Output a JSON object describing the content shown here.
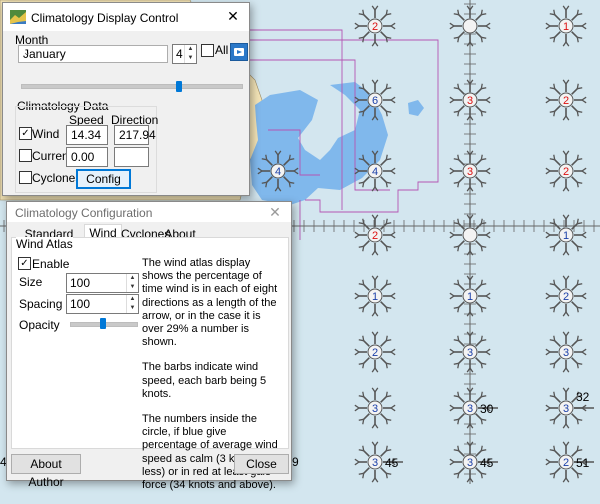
{
  "map": {
    "background_color": "#d3e6ef",
    "land_color": "#f2e3b6",
    "shallow_color": "#80b8ec",
    "graticule_label_color": "#333333",
    "barbs": [
      {
        "row": 0,
        "col": 0,
        "n": "2",
        "color": "red",
        "ext": ""
      },
      {
        "row": 0,
        "col": 1,
        "n": "",
        "color": "none",
        "ext": ""
      },
      {
        "row": 0,
        "col": 2,
        "n": "1",
        "color": "red",
        "ext": ""
      },
      {
        "row": 1,
        "col": 0,
        "n": "6",
        "color": "blue",
        "ext": ""
      },
      {
        "row": 1,
        "col": 1,
        "n": "3",
        "color": "red",
        "ext": ""
      },
      {
        "row": 1,
        "col": 2,
        "n": "2",
        "color": "red",
        "ext": ""
      },
      {
        "row": 2,
        "col": -1,
        "n": "4",
        "color": "blue",
        "ext": ""
      },
      {
        "row": 2,
        "col": 0,
        "n": "4",
        "color": "blue",
        "ext": ""
      },
      {
        "row": 2,
        "col": 1,
        "n": "3",
        "color": "red",
        "ext": ""
      },
      {
        "row": 2,
        "col": 2,
        "n": "2",
        "color": "red",
        "ext": ""
      },
      {
        "row": 3,
        "col": 0,
        "n": "2",
        "color": "red",
        "ext": ""
      },
      {
        "row": 3,
        "col": 1,
        "n": "",
        "color": "none",
        "ext": ""
      },
      {
        "row": 3,
        "col": 2,
        "n": "1",
        "color": "blue",
        "ext": ""
      },
      {
        "row": 4,
        "col": 0,
        "n": "1",
        "color": "blue",
        "ext": ""
      },
      {
        "row": 4,
        "col": 1,
        "n": "1",
        "color": "blue",
        "ext": ""
      },
      {
        "row": 4,
        "col": 2,
        "n": "2",
        "color": "blue",
        "ext": ""
      },
      {
        "row": 5,
        "col": 0,
        "n": "2",
        "color": "blue",
        "ext": ""
      },
      {
        "row": 5,
        "col": 1,
        "n": "3",
        "color": "blue",
        "ext": ""
      },
      {
        "row": 5,
        "col": 2,
        "n": "3",
        "color": "blue",
        "ext": ""
      },
      {
        "row": 6,
        "col": 0,
        "n": "3",
        "color": "blue",
        "ext": ""
      },
      {
        "row": 6,
        "col": 1,
        "n": "3",
        "color": "blue",
        "ext": "30"
      },
      {
        "row": 6,
        "col": 2,
        "n": "3",
        "color": "blue",
        "ext": "32"
      },
      {
        "row": 7,
        "col": 0,
        "n": "3",
        "color": "blue",
        "ext": "45"
      },
      {
        "row": 7,
        "col": 1,
        "n": "3",
        "color": "blue",
        "ext": "45"
      },
      {
        "row": 7,
        "col": 2,
        "n": "2",
        "color": "blue",
        "ext": "51"
      }
    ],
    "edge_labels": {
      "left": "4",
      "mid": "9"
    }
  },
  "display_control": {
    "title": "Climatology Display Control",
    "month_label": "Month",
    "month_value": "January",
    "month_number": "4",
    "all_label": "All",
    "data_label": "Climatology Data",
    "speed_header": "Speed",
    "direction_header": "Direction",
    "rows": [
      {
        "label": "Wind",
        "checked": true,
        "speed": "14.34",
        "direction": "217.94"
      },
      {
        "label": "Current",
        "checked": false,
        "speed": "0.00",
        "direction": ""
      },
      {
        "label": "Cyclones",
        "checked": false,
        "speed": "",
        "direction": ""
      }
    ],
    "config_label": "Config",
    "time_slider_fraction": 0.72
  },
  "configuration": {
    "title": "Climatology Configuration",
    "tabs": [
      "Standard Displays",
      "Wind",
      "Cyclones",
      "About"
    ],
    "active_tab": "Wind",
    "group_label": "Wind Atlas",
    "enable_label": "Enable",
    "enable_checked": true,
    "size_label": "Size",
    "size_value": "100",
    "spacing_label": "Spacing",
    "spacing_value": "100",
    "opacity_label": "Opacity",
    "opacity_fraction": 0.5,
    "desc_p1": "The wind atlas display shows the percentage of time wind is in each of eight directions as a length of the arrow, or in the case it is over 29% a number is shown.",
    "desc_p2": "The barbs indicate wind speed, each barb being 5 knots.",
    "desc_p3": "The numbers inside the circle, if blue give percentage of average wind speed as calm (3 knots or less) or in red at least gale force (34 knots and above).",
    "about_author_label": "About Author",
    "close_label": "Close"
  }
}
